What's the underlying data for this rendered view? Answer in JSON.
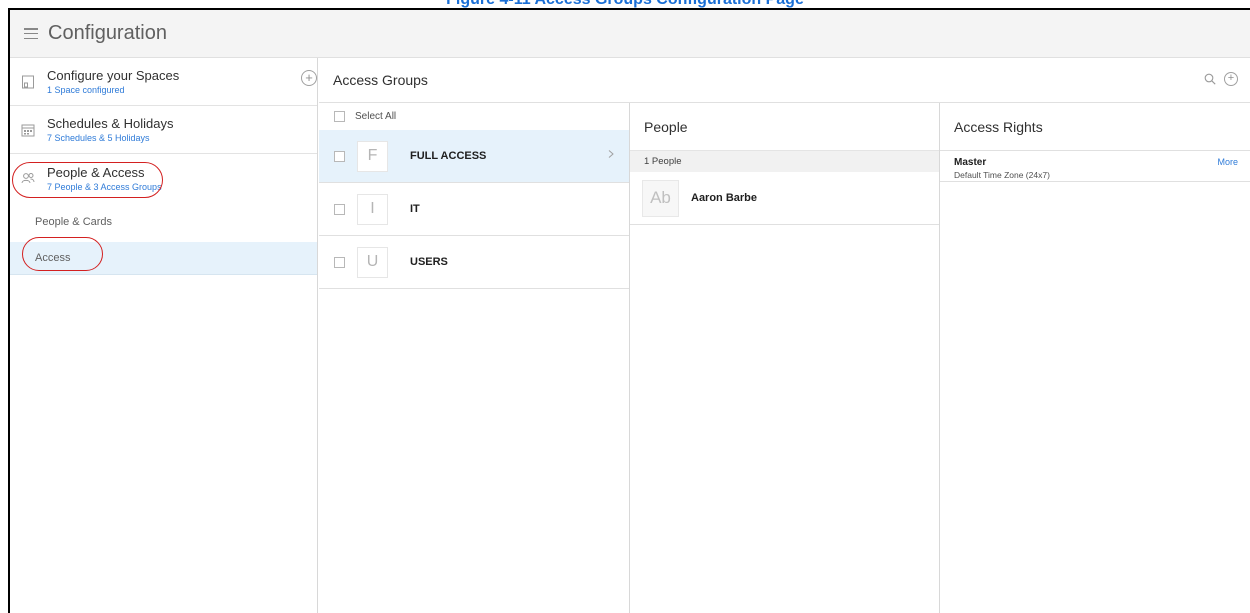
{
  "caption": {
    "text": "Figure 4-11 Access Groups Configuration Page"
  },
  "topbar": {
    "title": "Configuration"
  },
  "sidebar": {
    "items": [
      {
        "title": "Configure your Spaces",
        "subtitle": "1 Space configured"
      },
      {
        "title": "Schedules & Holidays",
        "subtitle": "7 Schedules & 5 Holidays"
      },
      {
        "title": "People & Access",
        "subtitle": "7 People & 3 Access Groups"
      }
    ],
    "subitems": [
      {
        "label": "People & Cards"
      },
      {
        "label": "Access"
      }
    ]
  },
  "main": {
    "title": "Access Groups"
  },
  "groups": {
    "select_all": "Select All",
    "rows": [
      {
        "initial": "F",
        "name": "FULL ACCESS"
      },
      {
        "initial": "I",
        "name": "IT"
      },
      {
        "initial": "U",
        "name": "USERS"
      }
    ]
  },
  "people": {
    "title": "People",
    "count": "1 People",
    "rows": [
      {
        "initials": "Ab",
        "name": "Aaron Barbe"
      }
    ]
  },
  "rights": {
    "title": "Access Rights",
    "rows": [
      {
        "title": "Master",
        "subtitle": "Default Time Zone (24x7)",
        "more": "More"
      }
    ]
  },
  "colors": {
    "accent": "#2f7bd8",
    "highlight": "#e6f2fb",
    "annotation": "#d32020"
  }
}
